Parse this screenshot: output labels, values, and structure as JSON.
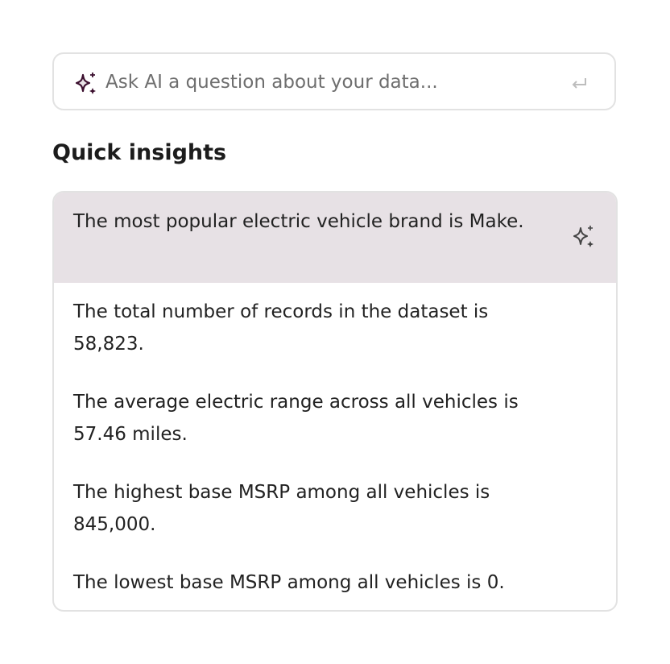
{
  "ask": {
    "placeholder": "Ask AI a question about your data..."
  },
  "colors": {
    "sparkle": "#3b0f2e",
    "highlight": "#e7e1e5",
    "border": "#e2e2e2"
  },
  "quick_insights": {
    "title": "Quick insights",
    "items": [
      {
        "text": "The most popular electric vehicle brand is Make."
      },
      {
        "text": "The total number of records in the dataset is 58,823."
      },
      {
        "text": "The average electric range across all vehicles is 57.46 miles."
      },
      {
        "text": "The highest base MSRP among all vehicles is 845,000."
      },
      {
        "text": "The lowest base MSRP among all vehicles is 0."
      }
    ]
  }
}
